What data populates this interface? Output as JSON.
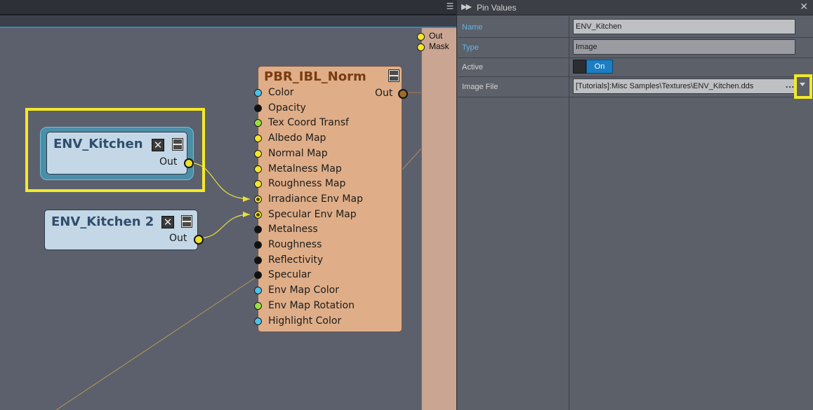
{
  "graph": {
    "strip_pins": [
      "Out",
      "Mask"
    ],
    "pbr_node": {
      "title": "PBR_IBL_Norm",
      "out_label": "Out",
      "inputs": [
        {
          "label": "Color",
          "color": "#4dc2e6"
        },
        {
          "label": "Opacity",
          "color": "#111111"
        },
        {
          "label": "Tex Coord Transf",
          "color": "#9be03a"
        },
        {
          "label": "Albedo Map",
          "color": "#f5e62a"
        },
        {
          "label": "Normal Map",
          "color": "#f5e62a"
        },
        {
          "label": "Metalness Map",
          "color": "#f5e62a"
        },
        {
          "label": "Roughness Map",
          "color": "#f5e62a"
        },
        {
          "label": "Irradiance Env Map",
          "color": "#f5e62a"
        },
        {
          "label": "Specular Env Map",
          "color": "#f5e62a"
        },
        {
          "label": "Metalness",
          "color": "#111111"
        },
        {
          "label": "Roughness",
          "color": "#111111"
        },
        {
          "label": "Reflectivity",
          "color": "#111111"
        },
        {
          "label": "Specular",
          "color": "#111111"
        },
        {
          "label": "Env Map Color",
          "color": "#4dc2e6"
        },
        {
          "label": "Env Map Rotation",
          "color": "#9be03a"
        },
        {
          "label": "Highlight Color",
          "color": "#4dc2e6"
        }
      ]
    },
    "texture_nodes": [
      {
        "title": "ENV_Kitchen",
        "out_label": "Out",
        "selected": true
      },
      {
        "title": "ENV_Kitchen 2",
        "out_label": "Out",
        "selected": false
      }
    ],
    "wire_color": "#e8df3a"
  },
  "panel": {
    "title": "Pin Values",
    "rows": {
      "name": {
        "label": "Name",
        "value": "ENV_Kitchen"
      },
      "type": {
        "label": "Type",
        "value": "Image"
      },
      "active": {
        "label": "Active",
        "value": "On"
      },
      "image_file": {
        "label": "Image File",
        "value": "[Tutorials]:Misc Samples\\Textures\\ENV_Kitchen.dds",
        "browse": "..."
      }
    }
  }
}
